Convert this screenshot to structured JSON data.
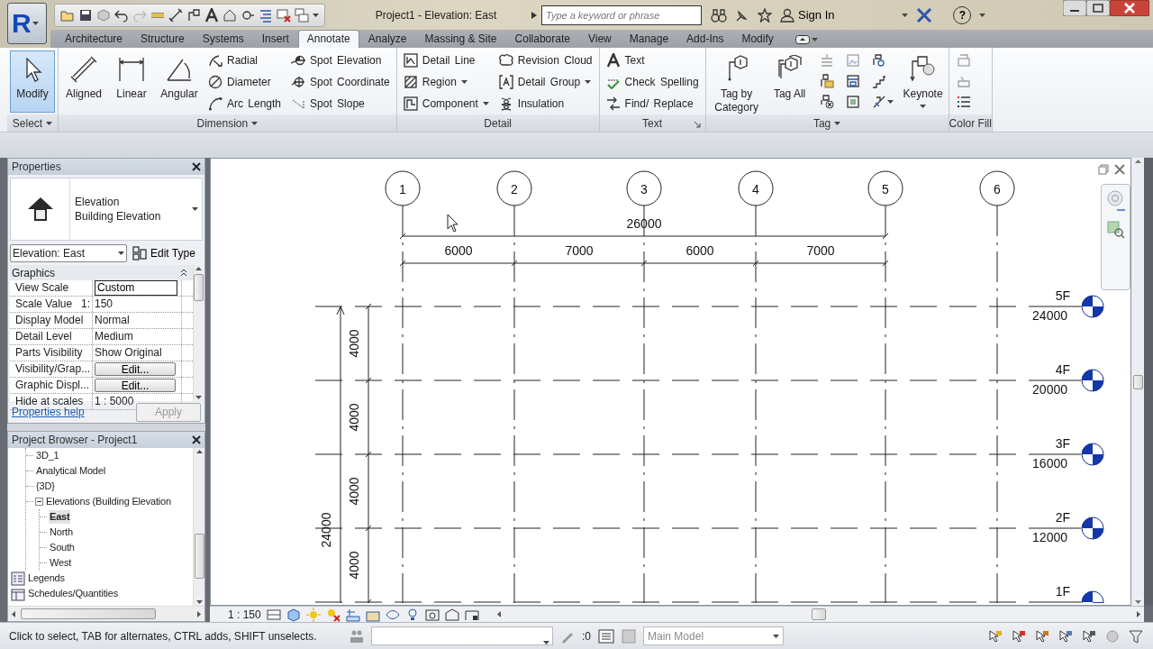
{
  "title_bar": {
    "app_button": "R",
    "title": "Project1 - Elevation: East",
    "search": {
      "placeholder": "Type a keyword or phrase"
    },
    "sign_in": "Sign In",
    "help": "?"
  },
  "ribbon_tabs": [
    {
      "label": "Architecture",
      "selected": false
    },
    {
      "label": "Structure",
      "selected": false
    },
    {
      "label": "Systems",
      "selected": false
    },
    {
      "label": "Insert",
      "selected": false
    },
    {
      "label": "Annotate",
      "selected": true
    },
    {
      "label": "Analyze",
      "selected": false
    },
    {
      "label": "Massing & Site",
      "selected": false
    },
    {
      "label": "Collaborate",
      "selected": false
    },
    {
      "label": "View",
      "selected": false
    },
    {
      "label": "Manage",
      "selected": false
    },
    {
      "label": "Add-Ins",
      "selected": false
    },
    {
      "label": "Modify",
      "selected": false
    }
  ],
  "ribbon": {
    "panels": [
      {
        "title": "Select",
        "has_menu": true,
        "columns": [
          {
            "tools": [
              {
                "kind": "large",
                "label": "Modify",
                "selected": true
              }
            ]
          }
        ]
      },
      {
        "title": "Dimension",
        "has_menu": true,
        "columns": [
          {
            "tools": [
              {
                "kind": "large",
                "label": "Aligned",
                "selected": false
              }
            ]
          },
          {
            "tools": [
              {
                "kind": "large",
                "label": "Linear",
                "selected": false
              }
            ]
          },
          {
            "tools": [
              {
                "kind": "large",
                "label": "Angular",
                "selected": false
              }
            ]
          },
          {
            "tools": [
              {
                "kind": "small",
                "label": "Radial",
                "selected": false
              },
              {
                "kind": "small",
                "label": "Diameter",
                "selected": false
              },
              {
                "kind": "small",
                "label": "Arc Length",
                "selected": false
              }
            ]
          },
          {
            "tools": [
              {
                "kind": "small",
                "label": "Spot Elevation",
                "selected": false
              },
              {
                "kind": "small",
                "label": "Spot Coordinate",
                "selected": false
              },
              {
                "kind": "small",
                "label": "Spot Slope",
                "selected": false
              }
            ]
          }
        ]
      },
      {
        "title": "Detail",
        "columns": [
          {
            "tools": [
              {
                "kind": "small",
                "label": "Detail Line",
                "selected": false
              },
              {
                "kind": "small",
                "label": "Region",
                "selected": false,
                "menu": true
              },
              {
                "kind": "small",
                "label": "Component",
                "selected": false,
                "menu": true
              }
            ]
          },
          {
            "tools": [
              {
                "kind": "small",
                "label": "Revision Cloud",
                "selected": false
              },
              {
                "kind": "small",
                "label": "Detail Group",
                "selected": false,
                "menu": true
              },
              {
                "kind": "small",
                "label": "Insulation",
                "selected": false
              }
            ]
          }
        ]
      },
      {
        "title": "Text",
        "has_launcher": true,
        "columns": [
          {
            "tools": [
              {
                "kind": "small",
                "label": "Text",
                "selected": false
              },
              {
                "kind": "small",
                "label": "Check Spelling",
                "selected": false
              },
              {
                "kind": "small",
                "label": "Find/ Replace",
                "selected": false
              }
            ]
          }
        ]
      },
      {
        "title": "Tag",
        "has_menu": true,
        "columns": [
          {
            "tools": [
              {
                "kind": "large",
                "label": "Tag by Category",
                "selected": false
              }
            ]
          },
          {
            "tools": [
              {
                "kind": "large",
                "label": "Tag All",
                "selected": false
              }
            ]
          },
          {
            "tools": [
              {
                "kind": "icon",
                "disabled": true
              },
              {
                "kind": "icon",
                "disabled": false
              },
              {
                "kind": "icon",
                "disabled": false
              }
            ]
          },
          {
            "tools": [
              {
                "kind": "icon",
                "disabled": true
              },
              {
                "kind": "icon",
                "disabled": false
              },
              {
                "kind": "icon",
                "disabled": false
              }
            ]
          },
          {
            "tools": [
              {
                "kind": "icon",
                "disabled": false
              },
              {
                "kind": "icon",
                "disabled": false
              },
              {
                "kind": "icon",
                "disabled": false,
                "menu": true
              }
            ]
          },
          {
            "tools": [
              {
                "kind": "large",
                "label": "Keynote",
                "selected": false,
                "menu": true
              }
            ]
          }
        ]
      },
      {
        "title": "Color Fill",
        "columns": [
          {
            "tools": [
              {
                "kind": "icon",
                "disabled": true
              },
              {
                "kind": "icon",
                "disabled": true
              },
              {
                "kind": "icon",
                "disabled": false
              }
            ]
          }
        ]
      }
    ]
  },
  "properties": {
    "title": "Properties",
    "type_name": "Elevation",
    "type_sub": "Building Elevation",
    "instance": "Elevation: East",
    "edit_type": "Edit Type",
    "group": "Graphics",
    "rows": [
      {
        "name": "View Scale",
        "value": "Custom",
        "kind": "field"
      },
      {
        "name": "Scale Value",
        "unit": "1:",
        "value": "150",
        "kind": "text"
      },
      {
        "name": "Display Model",
        "value": "Normal",
        "kind": "text"
      },
      {
        "name": "Detail Level",
        "value": "Medium",
        "kind": "text"
      },
      {
        "name": "Parts Visibility",
        "value": "Show Original",
        "kind": "text"
      },
      {
        "name": "Visibility/Grap...",
        "value": "Edit...",
        "kind": "button"
      },
      {
        "name": "Graphic Displ...",
        "value": "Edit...",
        "kind": "button"
      },
      {
        "name": "Hide at scales",
        "value": "1 : 5000",
        "kind": "text"
      }
    ],
    "help_link": "Properties help",
    "apply": {
      "label": "Apply",
      "disabled": true
    }
  },
  "project_browser": {
    "title": "Project Browser - Project1",
    "tree": [
      {
        "children": [
          {
            "label": "3D_1",
            "selected": false
          },
          {
            "label": "Analytical Model",
            "selected": false
          },
          {
            "label": "{3D}",
            "selected": false
          },
          {
            "label": "Elevations (Building Elevation",
            "selected": false,
            "expanded": true,
            "children": [
              {
                "label": "East",
                "selected": true
              },
              {
                "label": "North",
                "selected": false
              },
              {
                "label": "South",
                "selected": false
              },
              {
                "label": "West",
                "selected": false
              }
            ]
          }
        ]
      },
      {
        "label": "Legends",
        "selected": false
      },
      {
        "label": "Schedules/Quantities",
        "selected": false
      }
    ]
  },
  "view": {
    "grids": [
      {
        "label": "1"
      },
      {
        "label": "2"
      },
      {
        "label": "3"
      },
      {
        "label": "4"
      },
      {
        "label": "5"
      },
      {
        "label": "6"
      }
    ],
    "horizontal_dimensions": {
      "overall": "26000",
      "segments": [
        "6000",
        "7000",
        "6000",
        "7000"
      ]
    },
    "vertical_dimensions": {
      "overall": "24000",
      "segments": [
        "4000",
        "4000",
        "4000",
        "4000"
      ]
    },
    "levels": [
      {
        "name": "5F",
        "elevation": "24000"
      },
      {
        "name": "4F",
        "elevation": "20000"
      },
      {
        "name": "3F",
        "elevation": "16000"
      },
      {
        "name": "2F",
        "elevation": "12000"
      },
      {
        "name": "1F"
      }
    ]
  },
  "view_bar": {
    "scale": "1 : 150"
  },
  "status_bar": {
    "message": "Click to select, TAB for alternates, CTRL adds, SHIFT unselects.",
    "selection_count": ":0",
    "active_model": "Main Model"
  }
}
